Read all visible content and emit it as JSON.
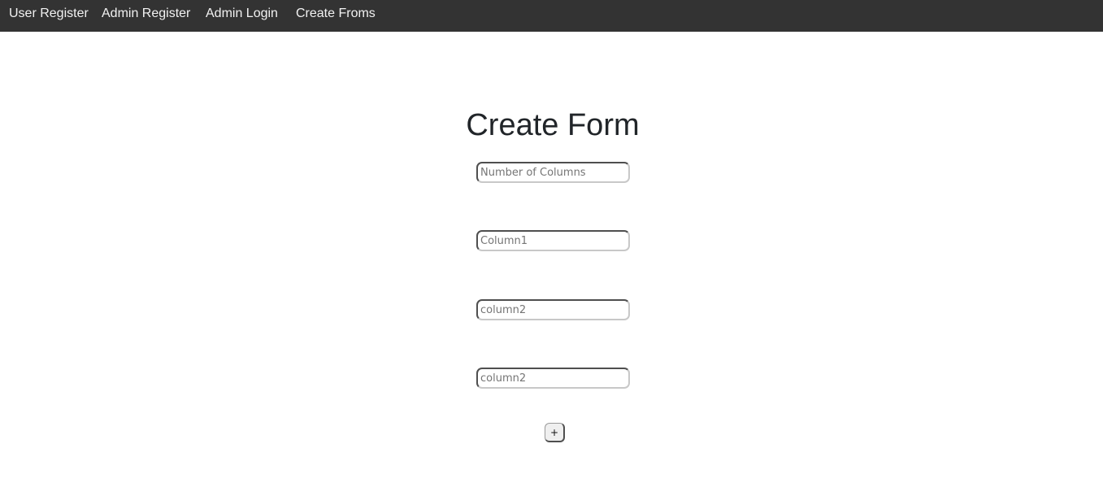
{
  "nav": {
    "user_register": "User Register",
    "admin_register": "Admin Register",
    "admin_login": "Admin Login",
    "create_forms": "Create Froms"
  },
  "form": {
    "title": "Create Form",
    "fields": [
      {
        "value": "",
        "placeholder": "Number of Columns"
      },
      {
        "value": "",
        "placeholder": "Column1"
      },
      {
        "value": "",
        "placeholder": "column2"
      },
      {
        "value": "",
        "placeholder": "column2"
      }
    ],
    "add_button_label": "+"
  },
  "colors": {
    "navbar_bg": "#333333",
    "nav_text": "#f2f2f2",
    "title_text": "#212529",
    "button_bg": "#efefef"
  }
}
